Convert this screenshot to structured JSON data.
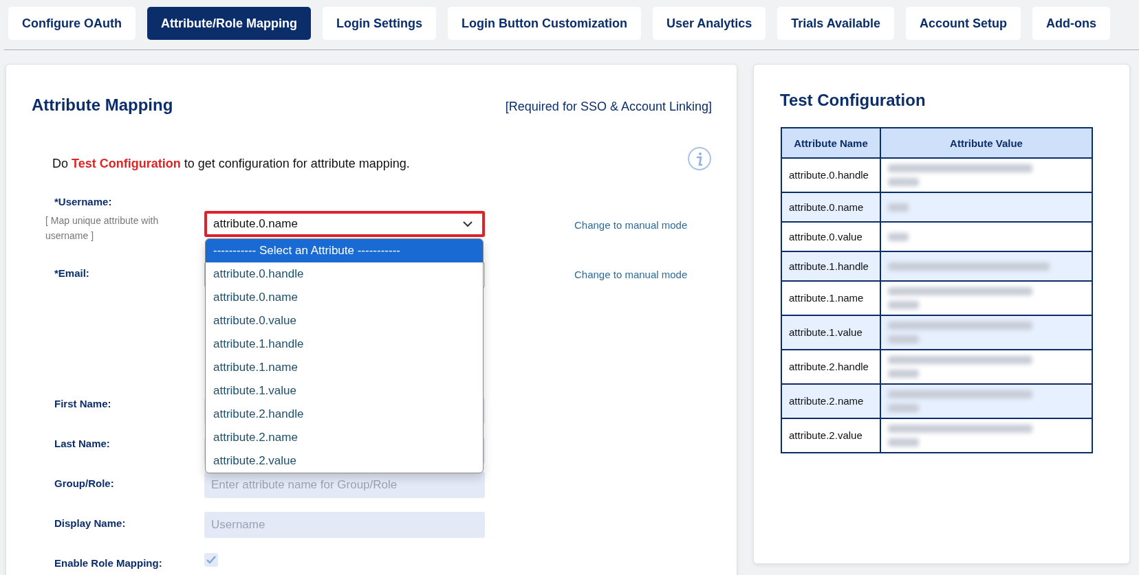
{
  "tabs": [
    {
      "label": "Configure OAuth",
      "selected": false
    },
    {
      "label": "Attribute/Role Mapping",
      "selected": true
    },
    {
      "label": "Login Settings",
      "selected": false
    },
    {
      "label": "Login Button Customization",
      "selected": false
    },
    {
      "label": "User Analytics",
      "selected": false
    },
    {
      "label": "Trials Available",
      "selected": false
    },
    {
      "label": "Account Setup",
      "selected": false
    },
    {
      "label": "Add-ons",
      "selected": false
    }
  ],
  "mapping": {
    "title": "Attribute Mapping",
    "note": "[Required for SSO & Account Linking]",
    "instruction": "Do **Test Configuration** to get configuration for attribute mapping.",
    "fields": [
      {
        "kind": "select",
        "label": "*Username:",
        "hint": "[ Map unique attribute with username ]",
        "value": "attribute.0.name",
        "highlighted": true,
        "link": "Change to manual mode"
      },
      {
        "kind": "select",
        "label": "*Email:",
        "highlighted": false,
        "link": "Change to manual mode"
      },
      {
        "kind": "text",
        "label": "First Name:"
      },
      {
        "kind": "text",
        "label": "Last Name:"
      },
      {
        "kind": "text",
        "label": "Group/Role:",
        "placeholder": "Enter attribute name for Group/Role"
      },
      {
        "kind": "text",
        "label": "Display Name:",
        "placeholder": "Username"
      },
      {
        "kind": "checkbox",
        "label": "Enable Role Mapping:",
        "checked": true
      }
    ],
    "dropdown": {
      "options": [
        {
          "label": "----------- Select an Attribute -----------",
          "selected": true
        },
        {
          "label": "attribute.0.handle",
          "selected": false
        },
        {
          "label": "attribute.0.name",
          "selected": false
        },
        {
          "label": "attribute.0.value",
          "selected": false
        },
        {
          "label": "attribute.1.handle",
          "selected": false
        },
        {
          "label": "attribute.1.name",
          "selected": false
        },
        {
          "label": "attribute.1.value",
          "selected": false
        },
        {
          "label": "attribute.2.handle",
          "selected": false
        },
        {
          "label": "attribute.2.name",
          "selected": false
        },
        {
          "label": "attribute.2.value",
          "selected": false
        }
      ]
    }
  },
  "test_configuration": {
    "title": "Test Configuration",
    "columns": [
      "Attribute Name",
      "Attribute Value"
    ],
    "rows": [
      {
        "name": "attribute.0.handle",
        "kind": "long"
      },
      {
        "name": "attribute.0.name",
        "kind": "short"
      },
      {
        "name": "attribute.0.value",
        "kind": "short"
      },
      {
        "name": "attribute.1.handle",
        "kind": "email"
      },
      {
        "name": "attribute.1.name",
        "kind": "long"
      },
      {
        "name": "attribute.1.value",
        "kind": "long"
      },
      {
        "name": "attribute.2.handle",
        "kind": "long"
      },
      {
        "name": "attribute.2.name",
        "kind": "long"
      },
      {
        "name": "attribute.2.value",
        "kind": "long"
      }
    ]
  }
}
